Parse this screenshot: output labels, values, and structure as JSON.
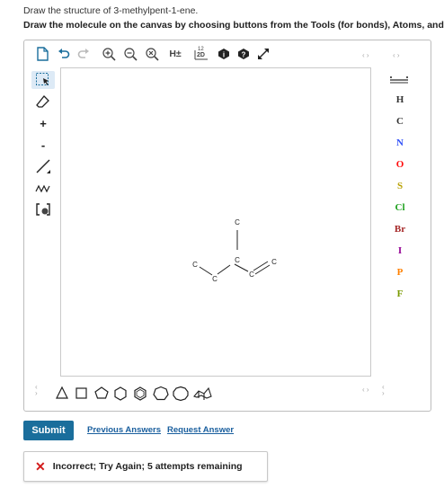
{
  "question": {
    "line1": "Draw the structure of 3-methylpent-1-ene.",
    "line2": "Draw the molecule on the canvas by choosing buttons from the Tools (for bonds), Atoms, and ."
  },
  "top_toolbar": {
    "h_label": "H±",
    "d2_label": "2D",
    "d2_sub": "12"
  },
  "left_tools": {
    "plus": "+",
    "minus": "-"
  },
  "atoms": [
    "H",
    "C",
    "N",
    "O",
    "S",
    "Cl",
    "Br",
    "I",
    "P",
    "F"
  ],
  "atom_colors": {
    "H": "#333333",
    "C": "#333333",
    "N": "#3050f8",
    "O": "#ff0d0d",
    "S": "#b8a000",
    "Cl": "#1ea01e",
    "Br": "#a62929",
    "I": "#940094",
    "P": "#ff8000",
    "F": "#7a9a00"
  },
  "molecule": {
    "atom_label": "C"
  },
  "buttons": {
    "submit": "Submit",
    "previous_answers": "Previous Answers",
    "request_answer": "Request Answer"
  },
  "feedback": {
    "icon": "✕",
    "message": "Incorrect; Try Again; 5 attempts remaining"
  }
}
